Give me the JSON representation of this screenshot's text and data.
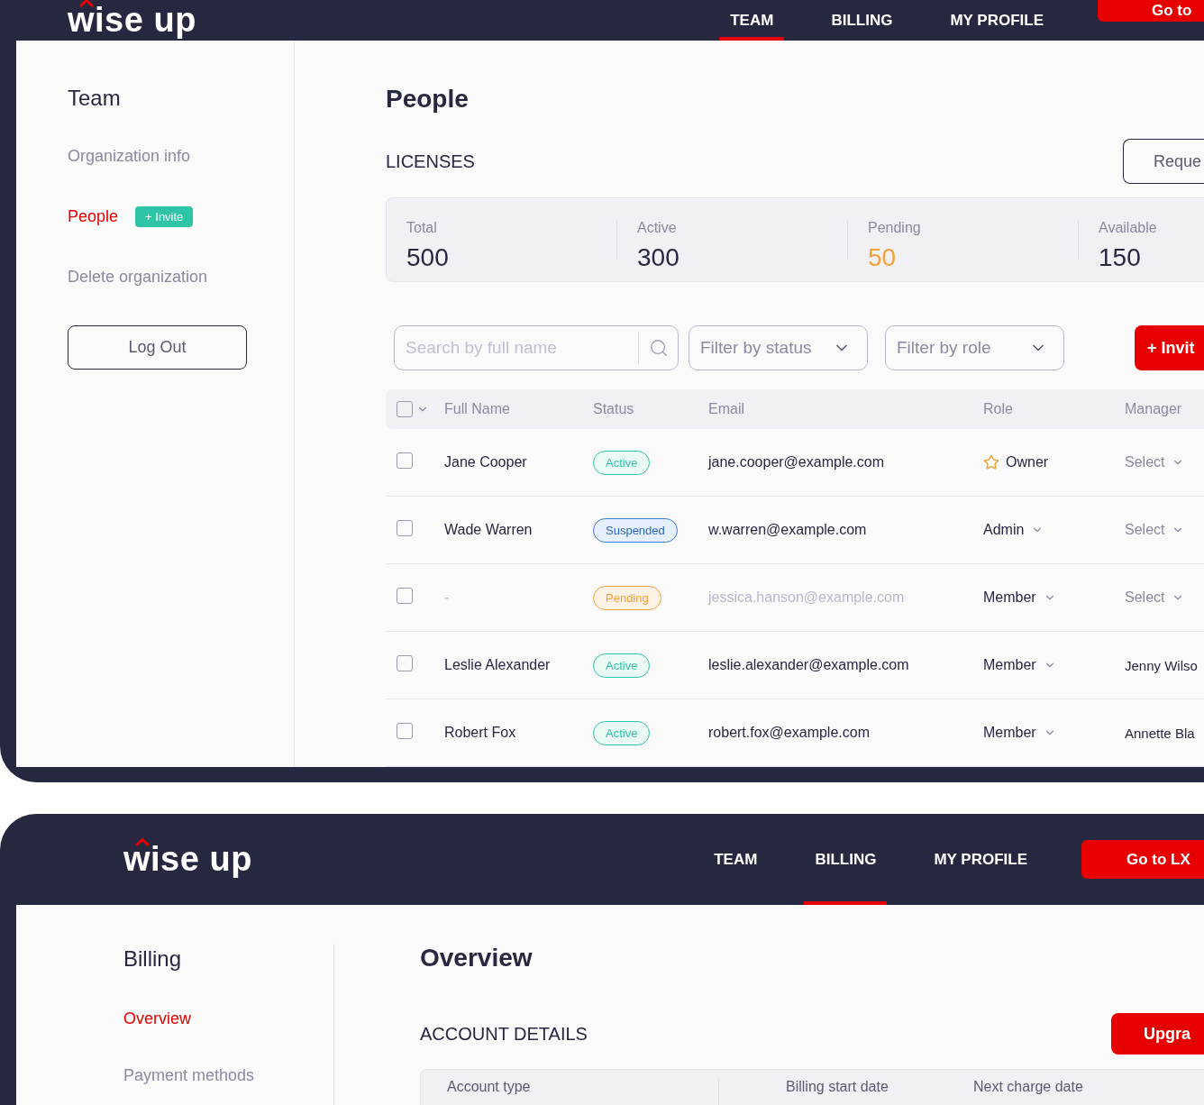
{
  "team_screen": {
    "logo": "wise up",
    "nav": [
      {
        "label": "TEAM",
        "selected": true
      },
      {
        "label": "BILLING",
        "selected": false
      },
      {
        "label": "MY PROFILE",
        "selected": false
      }
    ],
    "cta": "Go to",
    "sidebar": {
      "title": "Team",
      "items": [
        {
          "label": "Organization info",
          "selected": false
        },
        {
          "label": "People",
          "selected": true,
          "badge": "+ Invite"
        },
        {
          "label": "Delete organization",
          "selected": false
        }
      ],
      "logout": "Log Out"
    },
    "title": "People",
    "licenses_label": "LICENSES",
    "request_button": "Reque",
    "stats": [
      {
        "label": "Total",
        "value": "500",
        "color": "#262840"
      },
      {
        "label": "Active",
        "value": "300",
        "color": "#262840"
      },
      {
        "label": "Pending",
        "value": "50",
        "color": "#f5a13a"
      },
      {
        "label": "Available",
        "value": "150",
        "color": "#262840"
      }
    ],
    "search": {
      "placeholder": "Search by full name"
    },
    "filters": [
      {
        "placeholder": "Filter by status"
      },
      {
        "placeholder": "Filter by role"
      }
    ],
    "invite_button": "+ Invit",
    "table": {
      "select_all": {
        "checked": false
      },
      "columns": [
        "Full Name",
        "Status",
        "Email",
        "Role",
        "Manager"
      ],
      "rows": [
        {
          "checked": false,
          "name": "Jane Cooper",
          "status": {
            "label": "Active",
            "kind": "active"
          },
          "email": "jane.cooper@example.com",
          "muted": false,
          "role": {
            "label": "Owner",
            "kind": "owner"
          },
          "manager": {
            "label": "Select",
            "kind": "select"
          }
        },
        {
          "checked": false,
          "name": "Wade Warren",
          "status": {
            "label": "Suspended",
            "kind": "suspended"
          },
          "email": "w.warren@example.com",
          "muted": false,
          "role": {
            "label": "Admin",
            "kind": "dropdown"
          },
          "manager": {
            "label": "Select",
            "kind": "select"
          }
        },
        {
          "checked": false,
          "name": "-",
          "status": {
            "label": "Pending",
            "kind": "pending"
          },
          "email": "jessica.hanson@example.com",
          "muted": true,
          "role": {
            "label": "Member",
            "kind": "dropdown"
          },
          "manager": {
            "label": "Select",
            "kind": "select"
          }
        },
        {
          "checked": false,
          "name": "Leslie Alexander",
          "status": {
            "label": "Active",
            "kind": "active"
          },
          "email": "leslie.alexander@example.com",
          "muted": false,
          "role": {
            "label": "Member",
            "kind": "dropdown"
          },
          "manager": {
            "label": "Jenny Wilso",
            "kind": "name"
          }
        },
        {
          "checked": false,
          "name": "Robert Fox",
          "status": {
            "label": "Active",
            "kind": "active"
          },
          "email": "robert.fox@example.com",
          "muted": false,
          "role": {
            "label": "Member",
            "kind": "dropdown"
          },
          "manager": {
            "label": "Annette Bla",
            "kind": "name"
          }
        }
      ]
    }
  },
  "billing_screen": {
    "logo": "wise up",
    "nav": [
      {
        "label": "TEAM",
        "selected": false
      },
      {
        "label": "BILLING",
        "selected": true
      },
      {
        "label": "MY PROFILE",
        "selected": false
      }
    ],
    "cta": "Go to LX",
    "sidebar": {
      "title": "Billing",
      "items": [
        {
          "label": "Overview",
          "selected": true
        },
        {
          "label": "Payment methods",
          "selected": false
        }
      ]
    },
    "title": "Overview",
    "section_label": "ACCOUNT DETAILS",
    "upgrade_button": "Upgra",
    "details": [
      "Account type",
      "Billing start date",
      "Next charge date"
    ]
  }
}
